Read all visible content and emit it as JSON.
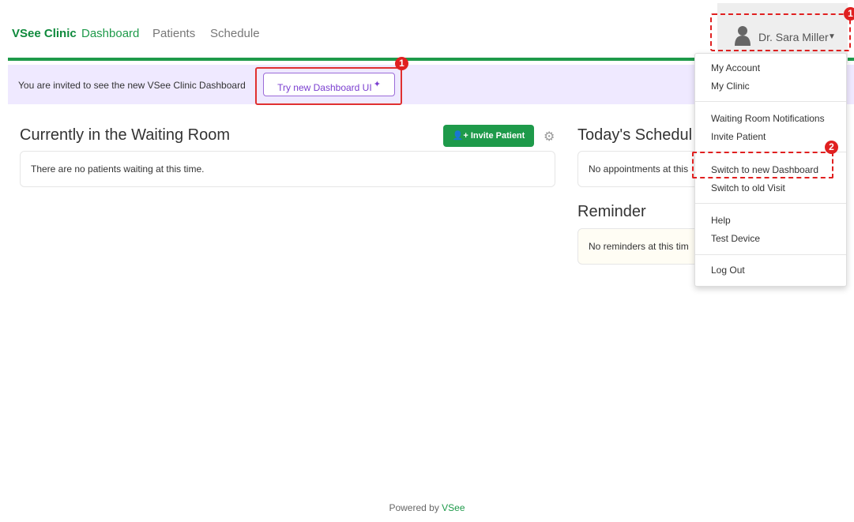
{
  "nav": {
    "brand": "VSee Clinic",
    "links": [
      "Dashboard",
      "Patients",
      "Schedule"
    ]
  },
  "user": {
    "name": "Dr. Sara Miller"
  },
  "banner": {
    "text": "You are invited to see the new VSee Clinic Dashboard",
    "button_label": "Try new Dashboard UI"
  },
  "waiting_room": {
    "title": "Currently in the Waiting Room",
    "invite_label": "Invite Patient",
    "empty_text": "There are no patients waiting at this time."
  },
  "schedule": {
    "title": "Today's Schedul",
    "empty_text": "No appointments at this"
  },
  "reminder": {
    "title": "Reminder",
    "empty_text": "No reminders at this tim"
  },
  "dropdown": {
    "items": [
      "My Account",
      "My Clinic",
      "Waiting Room Notifications",
      "Invite Patient",
      "Switch to new Dashboard",
      "Switch to old Visit",
      "Help",
      "Test Device",
      "Log Out"
    ]
  },
  "badges": {
    "first": "1",
    "second": "2"
  },
  "footer": {
    "prefix": "Powered by",
    "brand": "VSee"
  },
  "colors": {
    "brand_green": "#1e9a4a",
    "annotation_red": "#e02020",
    "banner_purple": "#efe9ff",
    "accent_purple": "#7b3fd0"
  }
}
